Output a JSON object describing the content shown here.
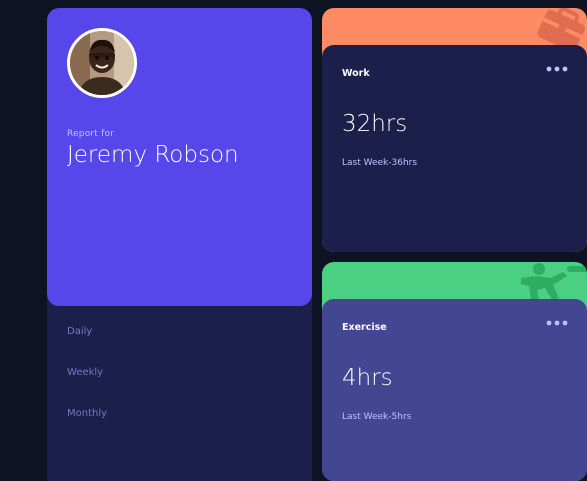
{
  "profile": {
    "report_for": "Report for",
    "name": "Jeremy Robson"
  },
  "timeframes": [
    "Daily",
    "Weekly",
    "Monthly"
  ],
  "activities": [
    {
      "title": "Work",
      "current": "32hrs",
      "previous": "Last Week-36hrs",
      "accent": "#ff8b64",
      "icon": "briefcase-icon"
    },
    {
      "title": "Exercise",
      "current": "4hrs",
      "previous": "Last Week-5hrs",
      "accent": "#4bcf82",
      "icon": "running-icon"
    }
  ],
  "colors": {
    "background": "#0d1323",
    "profile_card": "#5747ea",
    "panel": "#1c1f4a",
    "exercise_card": "#434690",
    "muted_text": "#bdc1ff",
    "timeframe_text": "#7078c9"
  },
  "menu_icon": "ellipsis-icon"
}
